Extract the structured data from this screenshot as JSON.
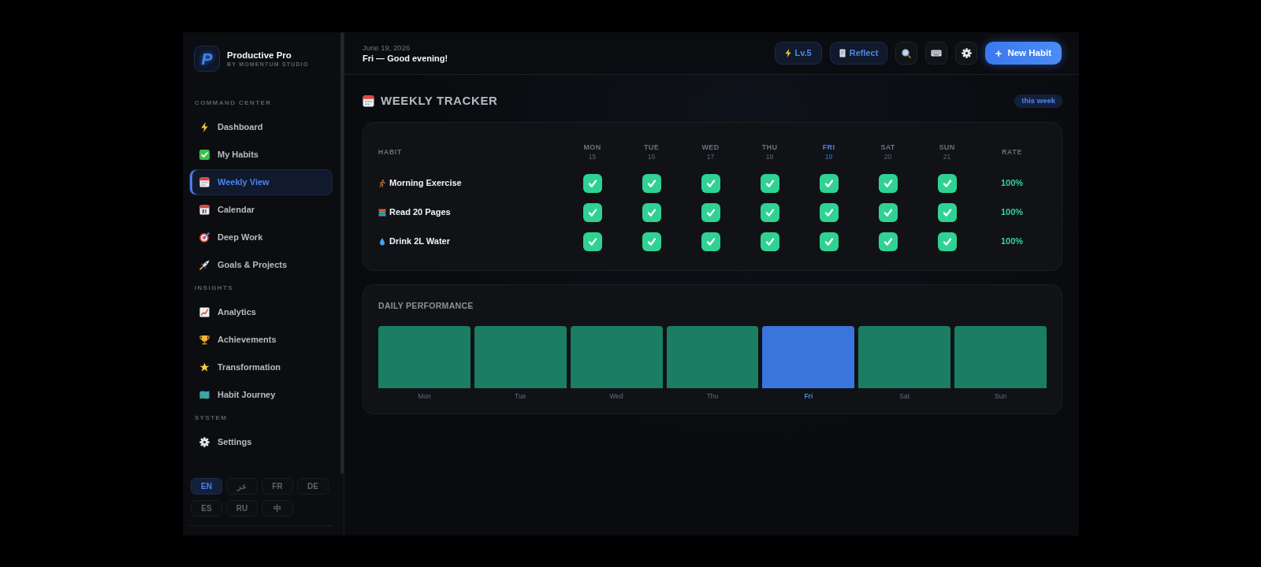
{
  "app": {
    "logo_letter": "P",
    "name": "Productive Pro",
    "subtitle": "BY MOMENTUM STUDIO"
  },
  "sidebar": {
    "sections": [
      {
        "title": "COMMAND CENTER",
        "items": [
          {
            "label": "Dashboard",
            "selected": false
          },
          {
            "label": "My Habits",
            "selected": false
          },
          {
            "label": "Weekly View",
            "selected": true
          },
          {
            "label": "Calendar",
            "selected": false
          },
          {
            "label": "Deep Work",
            "selected": false
          },
          {
            "label": "Goals & Projects",
            "selected": false
          }
        ]
      },
      {
        "title": "INSIGHTS",
        "items": [
          {
            "label": "Analytics",
            "selected": false
          },
          {
            "label": "Achievements",
            "selected": false
          },
          {
            "label": "Transformation",
            "selected": false
          },
          {
            "label": "Habit Journey",
            "selected": false
          }
        ]
      },
      {
        "title": "SYSTEM",
        "items": [
          {
            "label": "Settings",
            "selected": false
          }
        ]
      }
    ],
    "languages": [
      {
        "label": "EN",
        "selected": true
      },
      {
        "label": "عر",
        "selected": false
      },
      {
        "label": "FR",
        "selected": false
      },
      {
        "label": "DE",
        "selected": false
      },
      {
        "label": "ES",
        "selected": false
      },
      {
        "label": "RU",
        "selected": false
      },
      {
        "label": "中",
        "selected": false
      }
    ]
  },
  "header": {
    "date": "June 19, 2026",
    "greeting": "Fri — Good evening!",
    "level": "Lv.5",
    "reflect": "Reflect",
    "new_habit": "New Habit"
  },
  "tracker": {
    "title": "WEEKLY TRACKER",
    "badge": "this week",
    "habit_heading": "HABIT",
    "rate_heading": "RATE",
    "days": [
      {
        "label": "MON",
        "date": "15",
        "today": false
      },
      {
        "label": "TUE",
        "date": "16",
        "today": false
      },
      {
        "label": "WED",
        "date": "17",
        "today": false
      },
      {
        "label": "THU",
        "date": "18",
        "today": false
      },
      {
        "label": "FRI",
        "date": "19",
        "today": true
      },
      {
        "label": "SAT",
        "date": "20",
        "today": false
      },
      {
        "label": "SUN",
        "date": "21",
        "today": false
      }
    ],
    "habits": [
      {
        "name": "Morning Exercise",
        "cells": [
          {
            "checked": true
          },
          {
            "checked": true
          },
          {
            "checked": true
          },
          {
            "checked": true
          },
          {
            "checked": true
          },
          {
            "checked": true
          },
          {
            "checked": true
          }
        ],
        "rate": "100%"
      },
      {
        "name": "Read 20 Pages",
        "cells": [
          {
            "checked": true
          },
          {
            "checked": true
          },
          {
            "checked": true
          },
          {
            "checked": true
          },
          {
            "checked": true
          },
          {
            "checked": true
          },
          {
            "checked": true
          }
        ],
        "rate": "100%"
      },
      {
        "name": "Drink 2L Water",
        "cells": [
          {
            "checked": true
          },
          {
            "checked": true
          },
          {
            "checked": true
          },
          {
            "checked": true
          },
          {
            "checked": true
          },
          {
            "checked": true
          },
          {
            "checked": true
          }
        ],
        "rate": "100%"
      }
    ]
  },
  "performance": {
    "title": "DAILY PERFORMANCE",
    "bars": [
      {
        "label": "Mon",
        "today": false
      },
      {
        "label": "Tue",
        "today": false
      },
      {
        "label": "Wed",
        "today": false
      },
      {
        "label": "Thu",
        "today": false
      },
      {
        "label": "Fri",
        "today": true
      },
      {
        "label": "Sat",
        "today": false
      },
      {
        "label": "Sun",
        "today": false
      }
    ]
  }
}
